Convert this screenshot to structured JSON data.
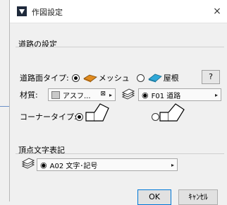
{
  "window": {
    "title": "作図設定",
    "close_symbol": "×"
  },
  "road": {
    "section_label": "道路の設定",
    "surface_label": "道路面タイプ:",
    "option_mesh": "メッシュ",
    "option_roof": "屋根",
    "help_label": "?",
    "material_label": "材質:",
    "material_value": "アスフ...",
    "layer_value": "F01 道路",
    "corner_label": "コーナータイプ:"
  },
  "vertex": {
    "section_label": "頂点文字表記",
    "layer_value": "A02 文字･記号"
  },
  "buttons": {
    "ok": "OK",
    "cancel": "ｷｬﾝｾﾙ"
  }
}
